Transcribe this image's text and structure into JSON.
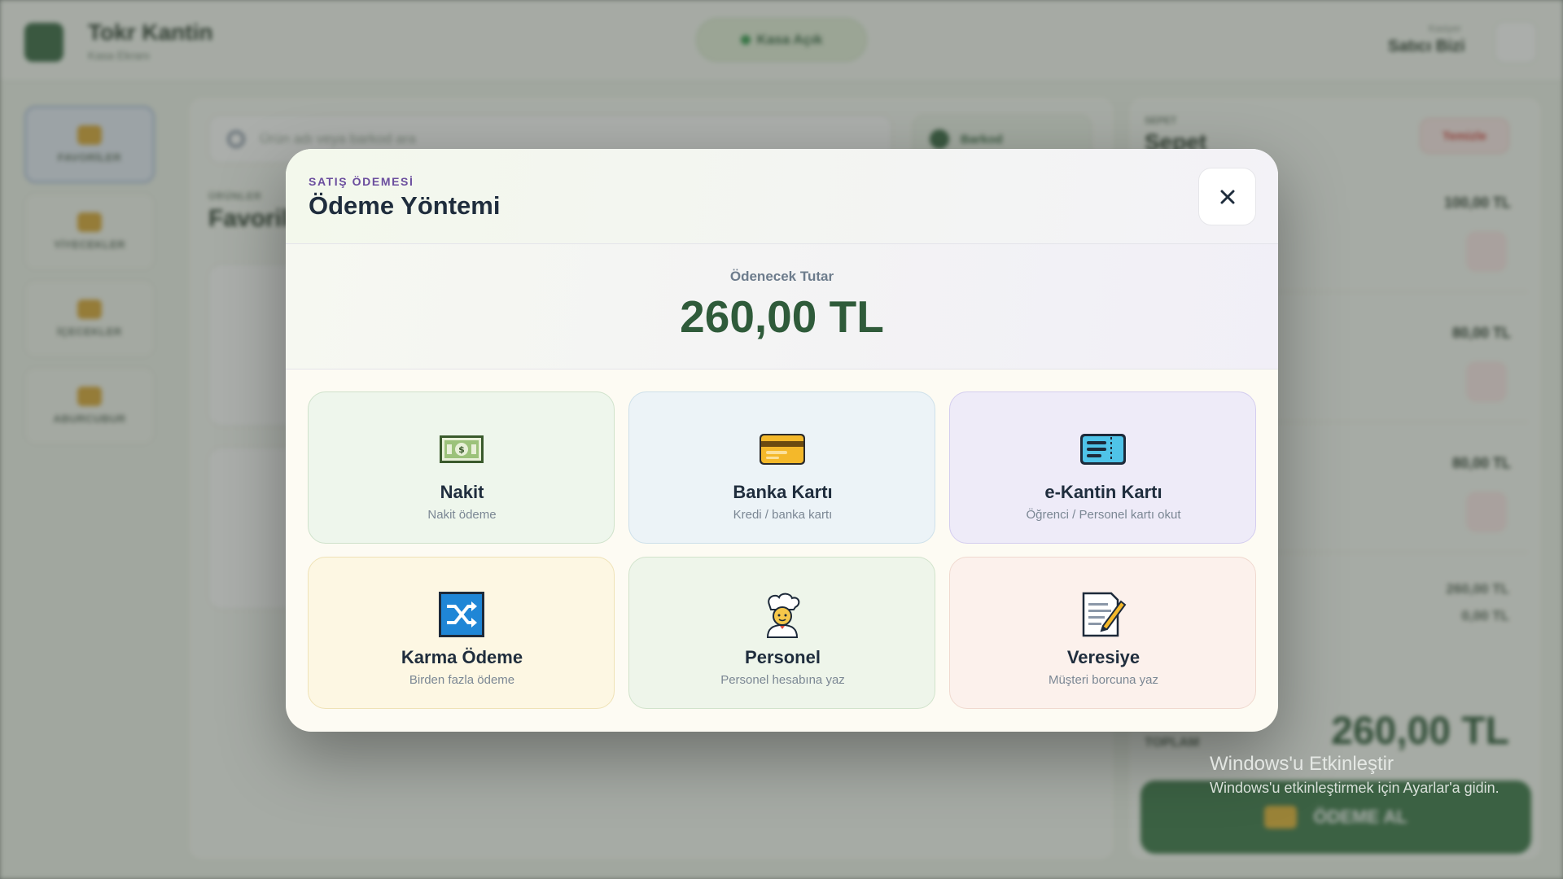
{
  "background": {
    "brand": {
      "title": "Tokr Kantin",
      "subtitle": "Kasa Ekranı"
    },
    "status": {
      "label": "Kasa Açık"
    },
    "cashier": {
      "label": "Kasiyer",
      "name": "Satıcı Bizi"
    },
    "sidebar": {
      "items": [
        {
          "label": "FAVORİLER"
        },
        {
          "label": "YİYECEKLER"
        },
        {
          "label": "İÇECEKLER"
        },
        {
          "label": "ABURCUBUR"
        }
      ]
    },
    "search": {
      "placeholder": "Ürün adı veya barkod ara"
    },
    "barcode": {
      "label": "Barkod"
    },
    "section": {
      "label": "ÜRÜNLER",
      "title": "Favoriler"
    },
    "cart": {
      "label": "SEPET",
      "title": "Sepet",
      "clear_label": "Temizle",
      "rows": [
        {
          "price": "100,00 TL"
        },
        {
          "price": "80,00 TL"
        },
        {
          "price": "80,00 TL"
        }
      ],
      "subtotal": "260,00 TL",
      "discount": "0,00 TL",
      "total_label": "TOPLAM",
      "total": "260,00 TL",
      "pay_label": "ÖDEME AL"
    }
  },
  "modal": {
    "kicker": "SATIŞ ÖDEMESİ",
    "title": "Ödeme Yöntemi",
    "amount_label": "Ödenecek Tutar",
    "amount": "260,00 TL",
    "methods": [
      {
        "title": "Nakit",
        "subtitle": "Nakit ödeme",
        "icon": "cash-icon"
      },
      {
        "title": "Banka Kartı",
        "subtitle": "Kredi / banka kartı",
        "icon": "credit-card-icon"
      },
      {
        "title": "e-Kantin Kartı",
        "subtitle": "Öğrenci / Personel kartı okut",
        "icon": "ticket-card-icon"
      },
      {
        "title": "Karma Ödeme",
        "subtitle": "Birden fazla ödeme",
        "icon": "shuffle-icon"
      },
      {
        "title": "Personel",
        "subtitle": "Personel hesabına yaz",
        "icon": "cook-icon"
      },
      {
        "title": "Veresiye",
        "subtitle": "Müşteri borcuna yaz",
        "icon": "memo-icon"
      }
    ]
  },
  "watermark": {
    "title": "Windows'u Etkinleştir",
    "subtitle": "Windows'u etkinleştirmek için Ayarlar'a gidin."
  }
}
